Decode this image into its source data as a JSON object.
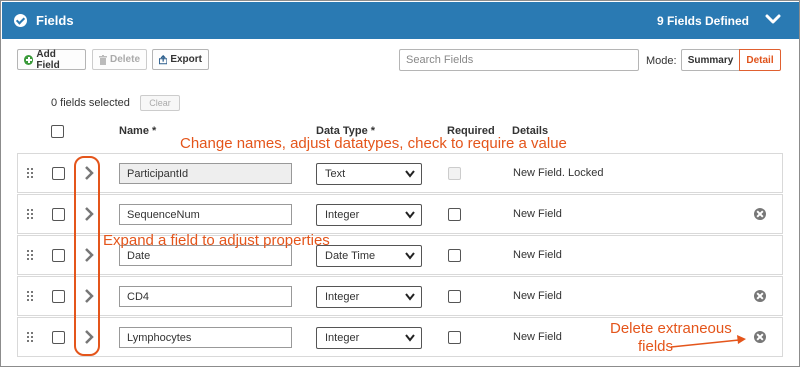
{
  "header": {
    "title": "Fields",
    "count_label": "9 Fields Defined"
  },
  "toolbar": {
    "add_label": "Add Field",
    "delete_label": "Delete",
    "export_label": "Export",
    "search_placeholder": "Search Fields",
    "mode_label": "Mode:",
    "mode_summary": "Summary",
    "mode_detail": "Detail"
  },
  "selection": {
    "count_label": "0 fields selected",
    "clear_label": "Clear"
  },
  "columns": {
    "name": "Name *",
    "data_type": "Data Type *",
    "required": "Required",
    "details": "Details"
  },
  "rows": [
    {
      "name": "ParticipantId",
      "type": "Text",
      "details": "New Field. Locked"
    },
    {
      "name": "SequenceNum",
      "type": "Integer",
      "details": "New Field"
    },
    {
      "name": "Date",
      "type": "Date Time",
      "details": "New Field"
    },
    {
      "name": "CD4",
      "type": "Integer",
      "details": "New Field"
    },
    {
      "name": "Lymphocytes",
      "type": "Integer",
      "details": "New Field"
    }
  ],
  "annotations": {
    "top": "Change names, adjust datatypes, check to require a value",
    "middle": "Expand a field to adjust properties",
    "delete_line1": "Delete extraneous",
    "delete_line2": "fields"
  },
  "colors": {
    "header_bg": "#2a7ab3",
    "annotation": "#e4551b",
    "detail_accent": "#e0531b"
  }
}
